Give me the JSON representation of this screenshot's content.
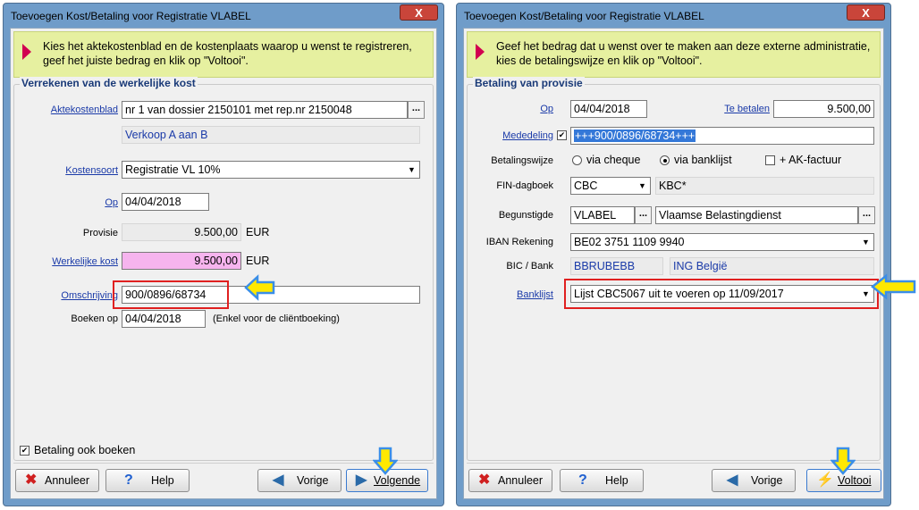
{
  "left": {
    "title": "Toevoegen Kost/Betaling voor Registratie VLABEL",
    "close": "X",
    "info": "Kies het aktekostenblad en de kostenplaats waarop u wenst te registreren, geef het juiste bedrag en klik op \"Voltooi\".",
    "legend": "Verrekenen van de werkelijke kost",
    "aktekostenblad_label": "Aktekostenblad",
    "aktekostenblad_value": "nr 1 van dossier 2150101 met rep.nr 2150048",
    "aktekostenblad_desc": "Verkoop A aan B",
    "kostensoort_label": "Kostensoort",
    "kostensoort_value": "Registratie VL 10%",
    "op_label": "Op",
    "op_value": "04/04/2018",
    "provisie_label": "Provisie",
    "provisie_value": "9.500,00",
    "provisie_unit": "EUR",
    "werkelijke_label": "Werkelijke kost",
    "werkelijke_value": "9.500,00",
    "werkelijke_unit": "EUR",
    "omschrijving_label": "Omschrijving",
    "omschrijving_value": "900/0896/68734",
    "boeken_label": "Boeken op",
    "boeken_value": "04/04/2018",
    "boeken_note": "(Enkel voor de cliëntboeking)",
    "betaling_ook_boeken": "Betaling ook boeken",
    "btn_annuleer": "Annuleer",
    "btn_help": "Help",
    "btn_vorige": "Vorige",
    "btn_volgende": "Volgende"
  },
  "right": {
    "title": "Toevoegen Kost/Betaling voor Registratie VLABEL",
    "close": "X",
    "info": "Geef het bedrag dat u wenst over te maken aan deze externe administratie, kies de betalingswijze en klik op \"Voltooi\".",
    "legend": "Betaling van provisie",
    "op_label": "Op",
    "op_value": "04/04/2018",
    "te_betalen_label": "Te betalen",
    "te_betalen_value": "9.500,00",
    "mededeling_label": "Mededeling",
    "mededeling_value": "+++900/0896/68734+++",
    "betalingswijze_label": "Betalingswijze",
    "via_cheque": "via cheque",
    "via_banklijst": "via banklijst",
    "ak_factuur": "+ AK-factuur",
    "fin_label": "FIN-dagboek",
    "fin_value": "CBC",
    "fin_desc": "KBC*",
    "begunstigde_label": "Begunstigde",
    "begunstigde_value": "VLABEL",
    "begunstigde_desc": "Vlaamse Belastingdienst",
    "iban_label": "IBAN Rekening",
    "iban_value": "BE02 3751 1109 9940",
    "bic_label": "BIC / Bank",
    "bic_value": "BBRUBEBB",
    "bank_value": "ING België",
    "banklijst_label": "Banklijst",
    "banklijst_value": "Lijst CBC5067 uit te voeren op 11/09/2017",
    "btn_annuleer": "Annuleer",
    "btn_help": "Help",
    "btn_vorige": "Vorige",
    "btn_voltooi": "Voltooi"
  },
  "colors": {
    "titlebar": "#6f9cc9",
    "info_bg": "#e6f0a0",
    "highlight_red": "#e02020",
    "arrow_yellow": "#ffe800",
    "arrow_blue": "#3a8ee8",
    "pink_field": "#f6b4ee"
  }
}
